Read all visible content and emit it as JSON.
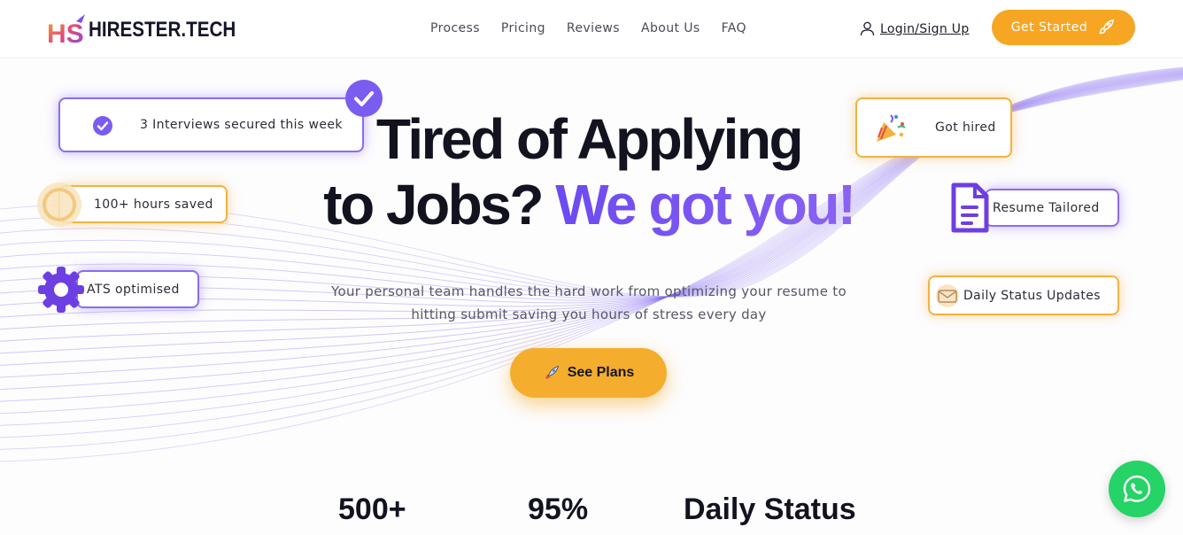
{
  "brand": {
    "logo_text": "HIRESTER.TECH"
  },
  "nav": {
    "items": [
      {
        "label": "Process"
      },
      {
        "label": "Pricing"
      },
      {
        "label": "Reviews"
      },
      {
        "label": "About Us"
      },
      {
        "label": "FAQ"
      }
    ],
    "login_label": "Login/Sign Up",
    "cta_label": "Get Started"
  },
  "hero": {
    "title_line1": "Tired of Applying",
    "title_line2_plain": "to Jobs?",
    "title_line2_accent": "We got you!",
    "subtitle_line1": "Your personal team handles the hard work from optimizing your resume to",
    "subtitle_line2": "hitting submit saving you hours of stress every day",
    "cta_label": "See Plans"
  },
  "badges": {
    "interviews": "3 Interviews secured this week",
    "hours": "100+ hours saved",
    "ats": "ATS optimised",
    "hired": "Got hired",
    "resume": "Resume Tailored",
    "status": "Daily Status Updates"
  },
  "stats": [
    {
      "value": "500+"
    },
    {
      "value": "95%"
    },
    {
      "value": "Daily Status"
    }
  ],
  "colors": {
    "accent_purple": "#6d4af0",
    "accent_orange": "#f6a623",
    "whatsapp_green": "#25d366"
  },
  "icons": {
    "login": "user-icon",
    "get_started": "rocket-icon",
    "see_plans": "rocket-icon",
    "interviews": "check-circle-icon",
    "hours": "clock-icon",
    "ats": "gear-icon",
    "hired": "party-popper-icon",
    "resume": "document-icon",
    "status": "mail-icon",
    "chat": "whatsapp-icon"
  }
}
